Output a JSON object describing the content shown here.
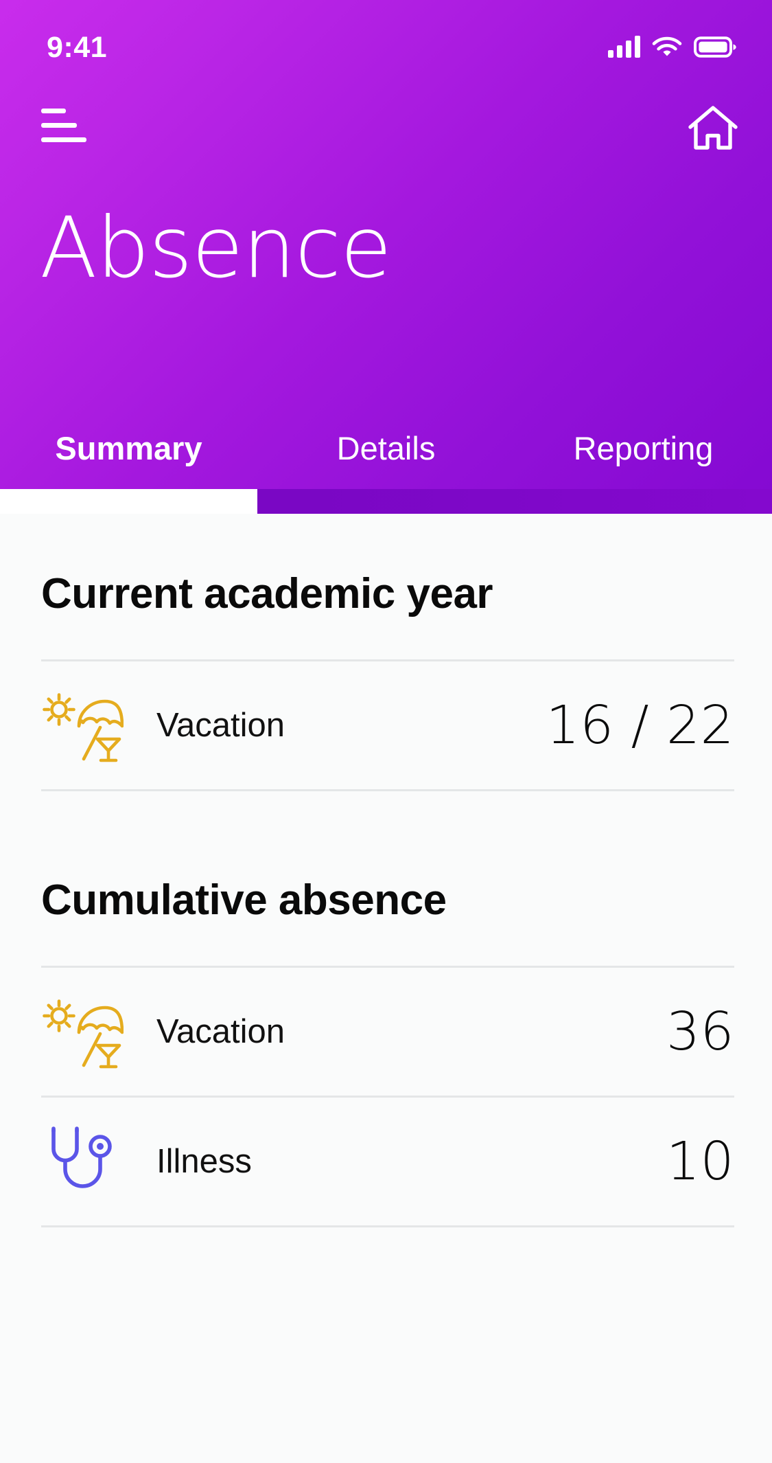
{
  "status_bar": {
    "time": "9:41",
    "signal_icon": "signal-bars-icon",
    "wifi_icon": "wifi-icon",
    "battery_icon": "battery-full-icon"
  },
  "header": {
    "menu_icon": "hamburger-menu-icon",
    "home_icon": "home-icon",
    "title": "Absence",
    "gradient_from": "#C92CEC",
    "gradient_to": "#8409D2",
    "indicator_color": "#FFFFFF"
  },
  "tabs": [
    {
      "label": "Summary",
      "active": true
    },
    {
      "label": "Details",
      "active": false
    },
    {
      "label": "Reporting",
      "active": false
    }
  ],
  "sections": [
    {
      "title": "Current academic year",
      "rows": [
        {
          "icon": "beach-umbrella-icon",
          "icon_color": "#E5AC1E",
          "label": "Vacation",
          "value": "16 / 22"
        }
      ]
    },
    {
      "title": "Cumulative absence",
      "rows": [
        {
          "icon": "beach-umbrella-icon",
          "icon_color": "#E5AC1E",
          "label": "Vacation",
          "value": "36"
        },
        {
          "icon": "stethoscope-icon",
          "icon_color": "#5B55E8",
          "label": "Illness",
          "value": "10"
        }
      ]
    }
  ]
}
